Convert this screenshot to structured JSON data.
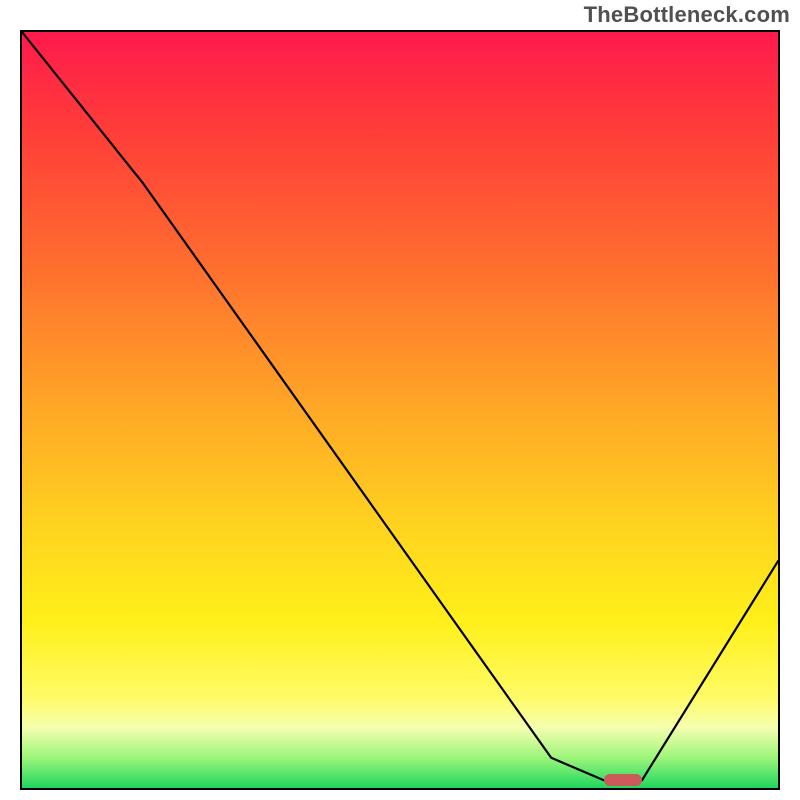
{
  "watermark": "TheBottleneck.com",
  "chart_data": {
    "type": "line",
    "title": "",
    "xlabel": "",
    "ylabel": "",
    "xlim": [
      0,
      100
    ],
    "ylim": [
      0,
      100
    ],
    "grid": false,
    "legend": false,
    "gradient_stops": [
      {
        "pos": 0,
        "color": "#ff1a4d"
      },
      {
        "pos": 12,
        "color": "#ff3a3a"
      },
      {
        "pos": 30,
        "color": "#ff6b2f"
      },
      {
        "pos": 50,
        "color": "#ffa826"
      },
      {
        "pos": 65,
        "color": "#ffd21f"
      },
      {
        "pos": 78,
        "color": "#fff01a"
      },
      {
        "pos": 88,
        "color": "#fffb66"
      },
      {
        "pos": 92,
        "color": "#f6ffb0"
      },
      {
        "pos": 96,
        "color": "#9cf57a"
      },
      {
        "pos": 100,
        "color": "#1fd65e"
      }
    ],
    "series": [
      {
        "name": "bottleneck-curve",
        "x": [
          0,
          16,
          70,
          77,
          82,
          100
        ],
        "y": [
          100,
          80,
          4,
          1,
          1,
          30
        ]
      }
    ],
    "marker": {
      "name": "optimal-range",
      "x_start": 77,
      "x_end": 82,
      "y": 1,
      "color": "#cc5a5a"
    }
  }
}
